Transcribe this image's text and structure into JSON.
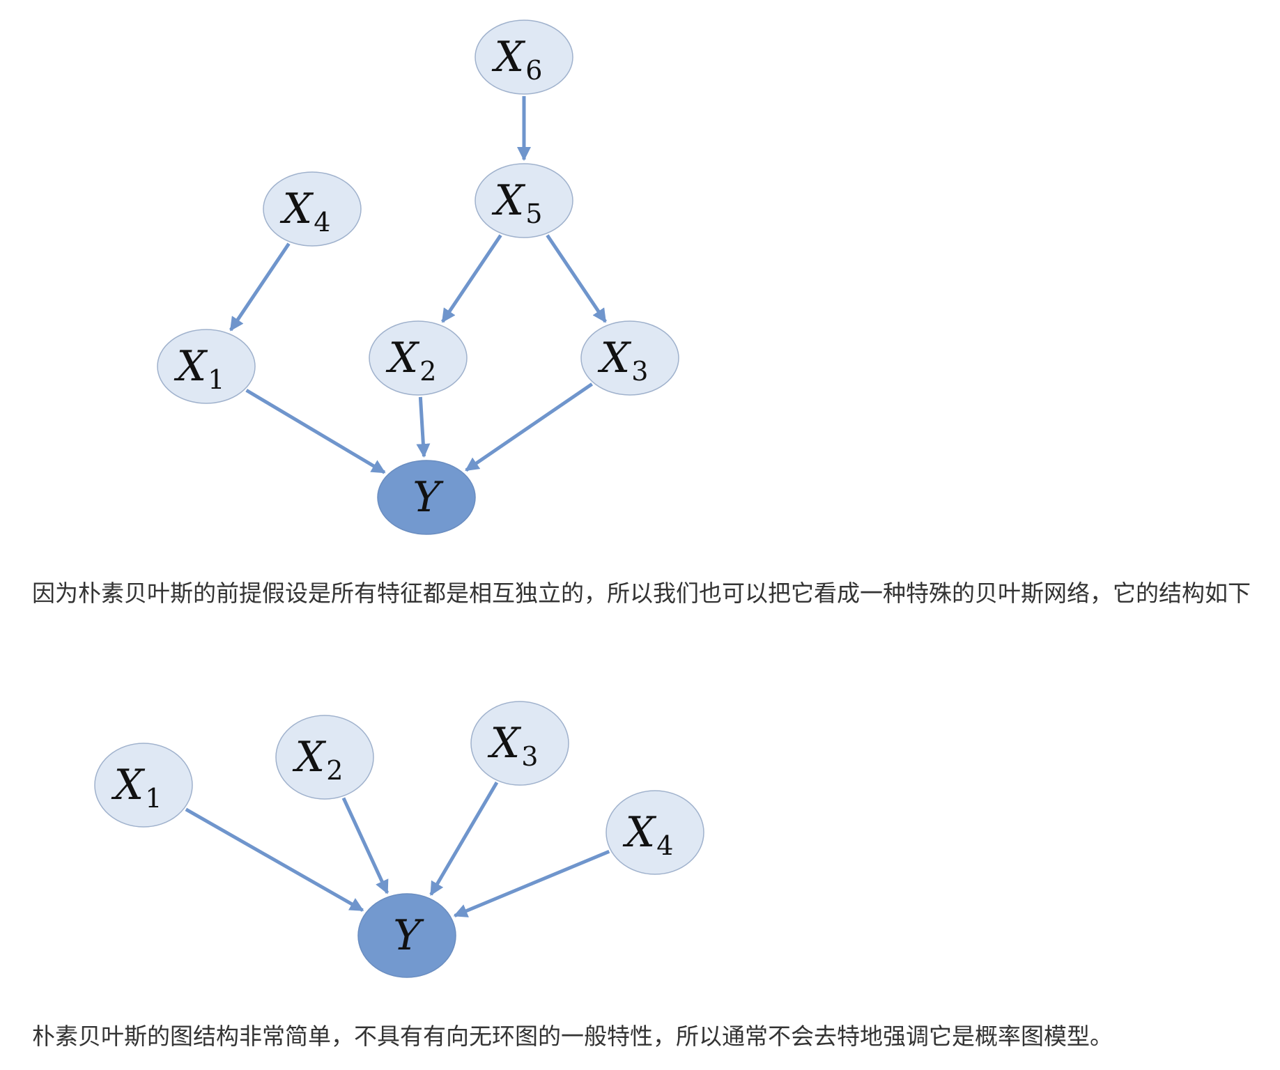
{
  "graph1": {
    "nodes": [
      {
        "id": "X6",
        "var": "X",
        "sub": "6",
        "style": "light"
      },
      {
        "id": "X5",
        "var": "X",
        "sub": "5",
        "style": "light"
      },
      {
        "id": "X4",
        "var": "X",
        "sub": "4",
        "style": "light"
      },
      {
        "id": "X1",
        "var": "X",
        "sub": "1",
        "style": "light"
      },
      {
        "id": "X2",
        "var": "X",
        "sub": "2",
        "style": "light"
      },
      {
        "id": "X3",
        "var": "X",
        "sub": "3",
        "style": "light"
      },
      {
        "id": "Y",
        "var": "Y",
        "sub": "",
        "style": "dark"
      }
    ],
    "edges": [
      {
        "from": "X6",
        "to": "X5"
      },
      {
        "from": "X4",
        "to": "X1"
      },
      {
        "from": "X5",
        "to": "X2"
      },
      {
        "from": "X5",
        "to": "X3"
      },
      {
        "from": "X1",
        "to": "Y"
      },
      {
        "from": "X2",
        "to": "Y"
      },
      {
        "from": "X3",
        "to": "Y"
      }
    ]
  },
  "text1": "因为朴素贝叶斯的前提假设是所有特征都是相互独立的，所以我们也可以把它看成一种特殊的贝叶斯网络，它的结构如下",
  "graph2": {
    "nodes": [
      {
        "id": "X1",
        "var": "X",
        "sub": "1",
        "style": "light"
      },
      {
        "id": "X2",
        "var": "X",
        "sub": "2",
        "style": "light"
      },
      {
        "id": "X3",
        "var": "X",
        "sub": "3",
        "style": "light"
      },
      {
        "id": "X4",
        "var": "X",
        "sub": "4",
        "style": "light"
      },
      {
        "id": "Y",
        "var": "Y",
        "sub": "",
        "style": "dark"
      }
    ],
    "edges": [
      {
        "from": "X1",
        "to": "Y"
      },
      {
        "from": "X2",
        "to": "Y"
      },
      {
        "from": "X3",
        "to": "Y"
      },
      {
        "from": "X4",
        "to": "Y"
      }
    ]
  },
  "text2": "朴素贝叶斯的图结构非常简单，不具有有向无环图的一般特性，所以通常不会去特地强调它是概率图模型。",
  "colors": {
    "node_fill": "#dfe8f4",
    "node_stroke": "#9fb1cc",
    "target_fill": "#7399cf",
    "edge": "#6f95cc",
    "text": "#333333"
  }
}
